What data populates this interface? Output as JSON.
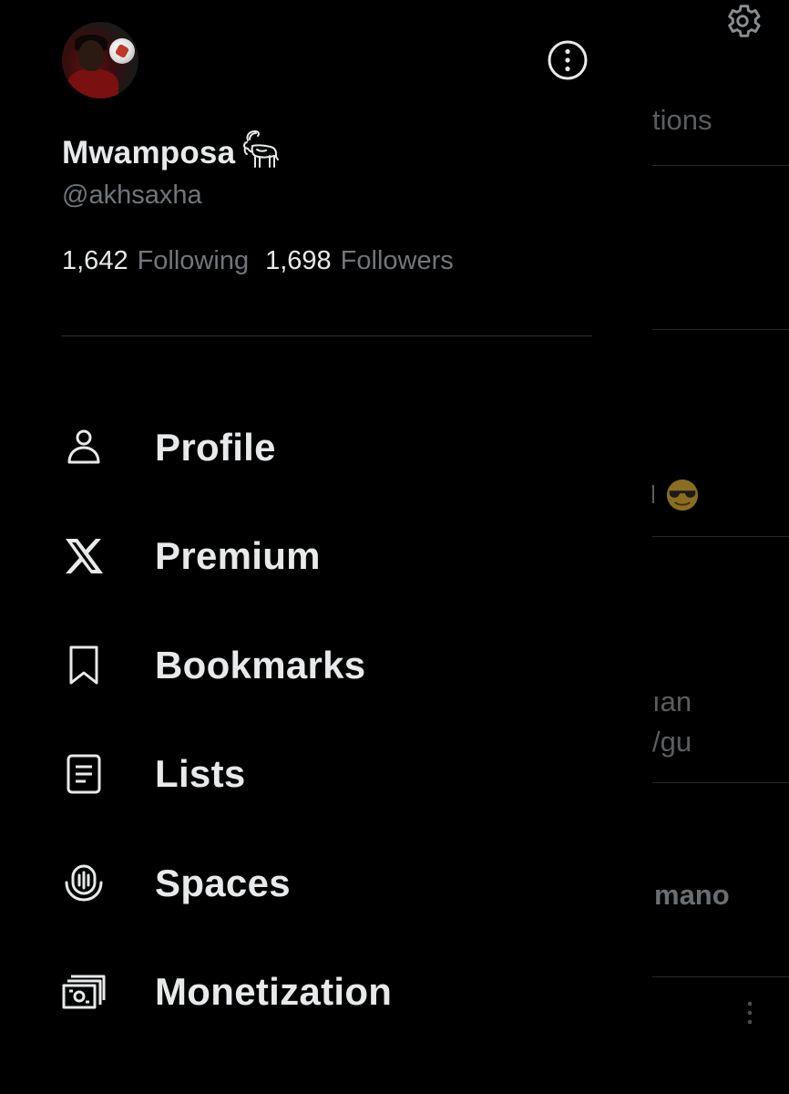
{
  "background_timeline": {
    "header_fragment": "tions",
    "text_fragment_1": "ıan",
    "text_fragment_2": "/gu",
    "text_fragment_3": "mano",
    "emoji": "sunglasses-face-emoji"
  },
  "profile": {
    "display_name": "Mwamposa",
    "name_badge_icon": "goat-icon",
    "handle": "@akhsaxha",
    "following_count": "1,642",
    "following_label": "Following",
    "followers_count": "1,698",
    "followers_label": "Followers"
  },
  "menu": [
    {
      "label": "Profile",
      "icon": "person-icon"
    },
    {
      "label": "Premium",
      "icon": "x-logo-icon"
    },
    {
      "label": "Bookmarks",
      "icon": "bookmark-icon"
    },
    {
      "label": "Lists",
      "icon": "list-icon"
    },
    {
      "label": "Spaces",
      "icon": "spaces-mic-icon"
    },
    {
      "label": "Monetization",
      "icon": "money-icon"
    }
  ],
  "colors": {
    "background": "#000000",
    "text_primary": "#e7e9ea",
    "text_secondary": "#71767b",
    "divider": "#2f3336"
  }
}
